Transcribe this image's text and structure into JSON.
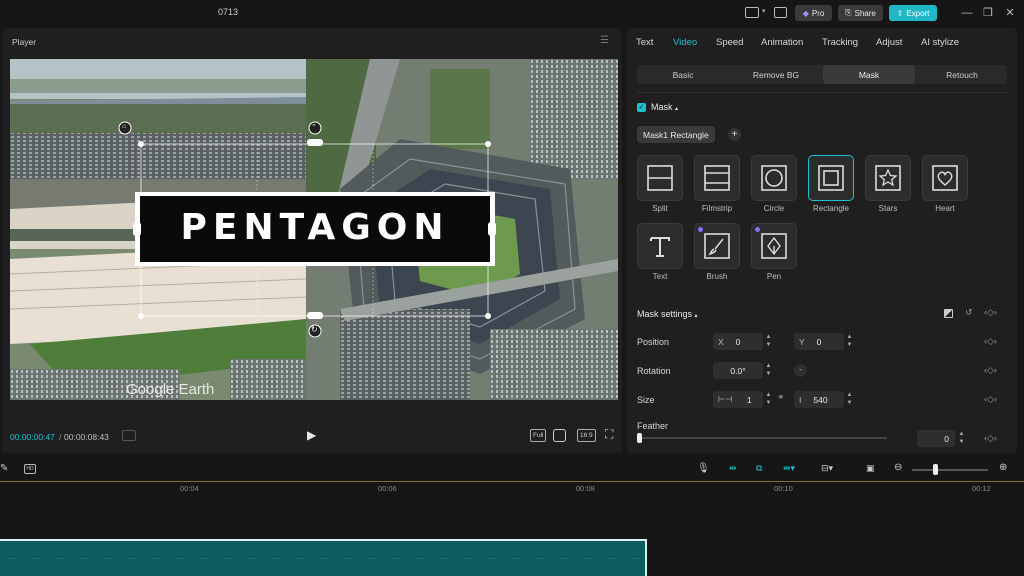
{
  "app": {
    "project_title": "0713",
    "pro_label": "Pro",
    "share_label": "Share",
    "export_label": "Export",
    "accent": "#1fc0d0"
  },
  "player": {
    "label": "Player",
    "overlay_text": "PENTAGON",
    "watermark": "Google Earth",
    "time_current": "00:00:00:47",
    "time_total": "00:00:08:43",
    "btn_full": "Full",
    "btn_ratio": "16:9"
  },
  "panel": {
    "tabs": [
      {
        "label": "Text"
      },
      {
        "label": "Video"
      },
      {
        "label": "Speed"
      },
      {
        "label": "Animation"
      },
      {
        "label": "Tracking"
      },
      {
        "label": "Adjust"
      },
      {
        "label": "AI stylize"
      }
    ],
    "active_tab": "Video",
    "subtabs": [
      {
        "label": "Basic"
      },
      {
        "label": "Remove BG"
      },
      {
        "label": "Mask"
      },
      {
        "label": "Retouch"
      }
    ],
    "active_subtab": "Mask",
    "mask_title": "Mask",
    "mask_chip": "Mask1 Rectangle",
    "mask_shapes": [
      {
        "label": "Split",
        "icon": "split-icon"
      },
      {
        "label": "Filmstrip",
        "icon": "filmstrip-icon"
      },
      {
        "label": "Circle",
        "icon": "circle-icon"
      },
      {
        "label": "Rectangle",
        "icon": "rectangle-icon"
      },
      {
        "label": "Stars",
        "icon": "star-icon"
      },
      {
        "label": "Heart",
        "icon": "heart-icon"
      },
      {
        "label": "Text",
        "icon": "text-icon"
      },
      {
        "label": "Brush",
        "icon": "brush-icon"
      },
      {
        "label": "Pen",
        "icon": "pen-icon"
      }
    ],
    "mask_settings_title": "Mask settings",
    "position": {
      "label": "Position",
      "x_label": "X",
      "x": "0",
      "y_label": "Y",
      "y": "0"
    },
    "rotation": {
      "label": "Rotation",
      "value": "0.0°"
    },
    "size": {
      "label": "Size",
      "w": "1",
      "h": "540"
    },
    "feather": {
      "label": "Feather",
      "value": "0"
    }
  },
  "timeline": {
    "ticks": [
      "00:04",
      "00:06",
      "00:08",
      "00:10",
      "00:12"
    ]
  }
}
